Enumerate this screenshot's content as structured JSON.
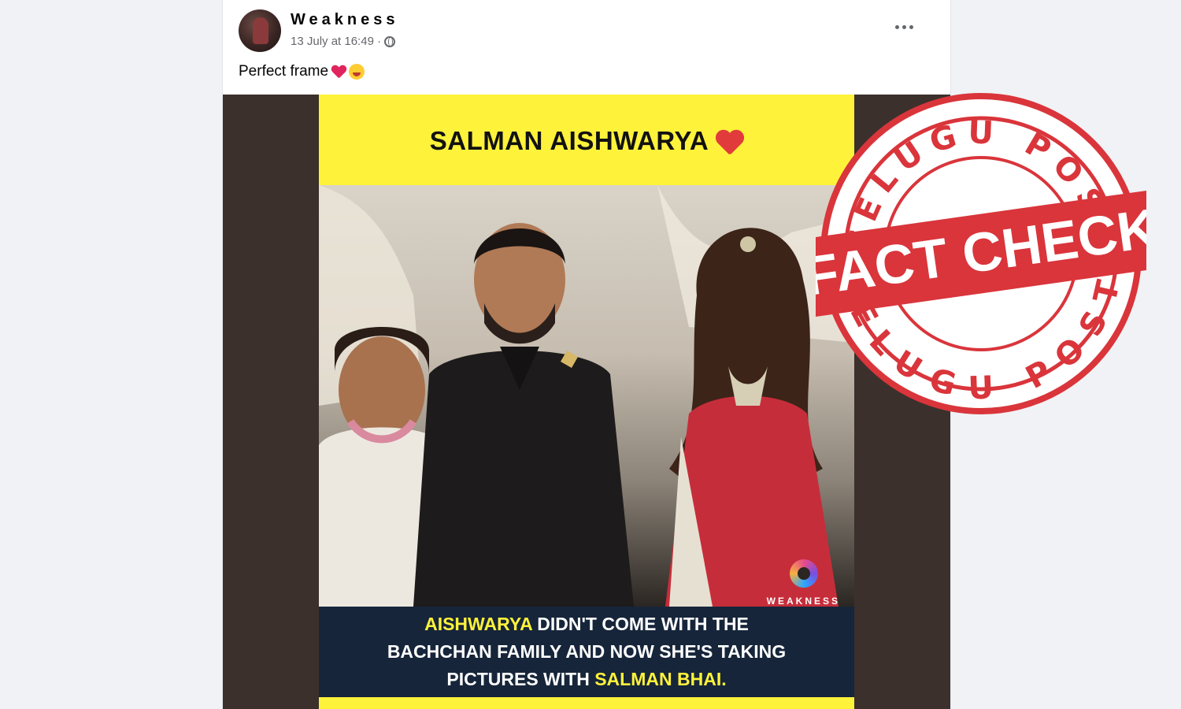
{
  "post": {
    "author": "Weakness",
    "timestamp": "13 July at 16:49 ·",
    "text": "Perfect frame",
    "emoji_1": "heart-emoji",
    "emoji_2": "smiling-face-emoji"
  },
  "image": {
    "title": "SALMAN AISHWARYA",
    "brand": "WEAKNESS",
    "caption": {
      "line1_highlight": "AISHWARYA",
      "line1_rest": " DIDN'T COME WITH THE",
      "line2": "BACHCHAN FAMILY AND NOW SHE'S TAKING",
      "line3_rest": "PICTURES WITH ",
      "line3_highlight": "SALMAN BHAI."
    }
  },
  "stamp": {
    "top_text": "TELUGU POST",
    "bottom_text": "TELUGU POST",
    "banner": "FACT CHECK",
    "color": "#d9353b"
  },
  "colors": {
    "image_bg": "#fff23a",
    "caption_bg": "#16253a",
    "highlight": "#fff23a"
  }
}
